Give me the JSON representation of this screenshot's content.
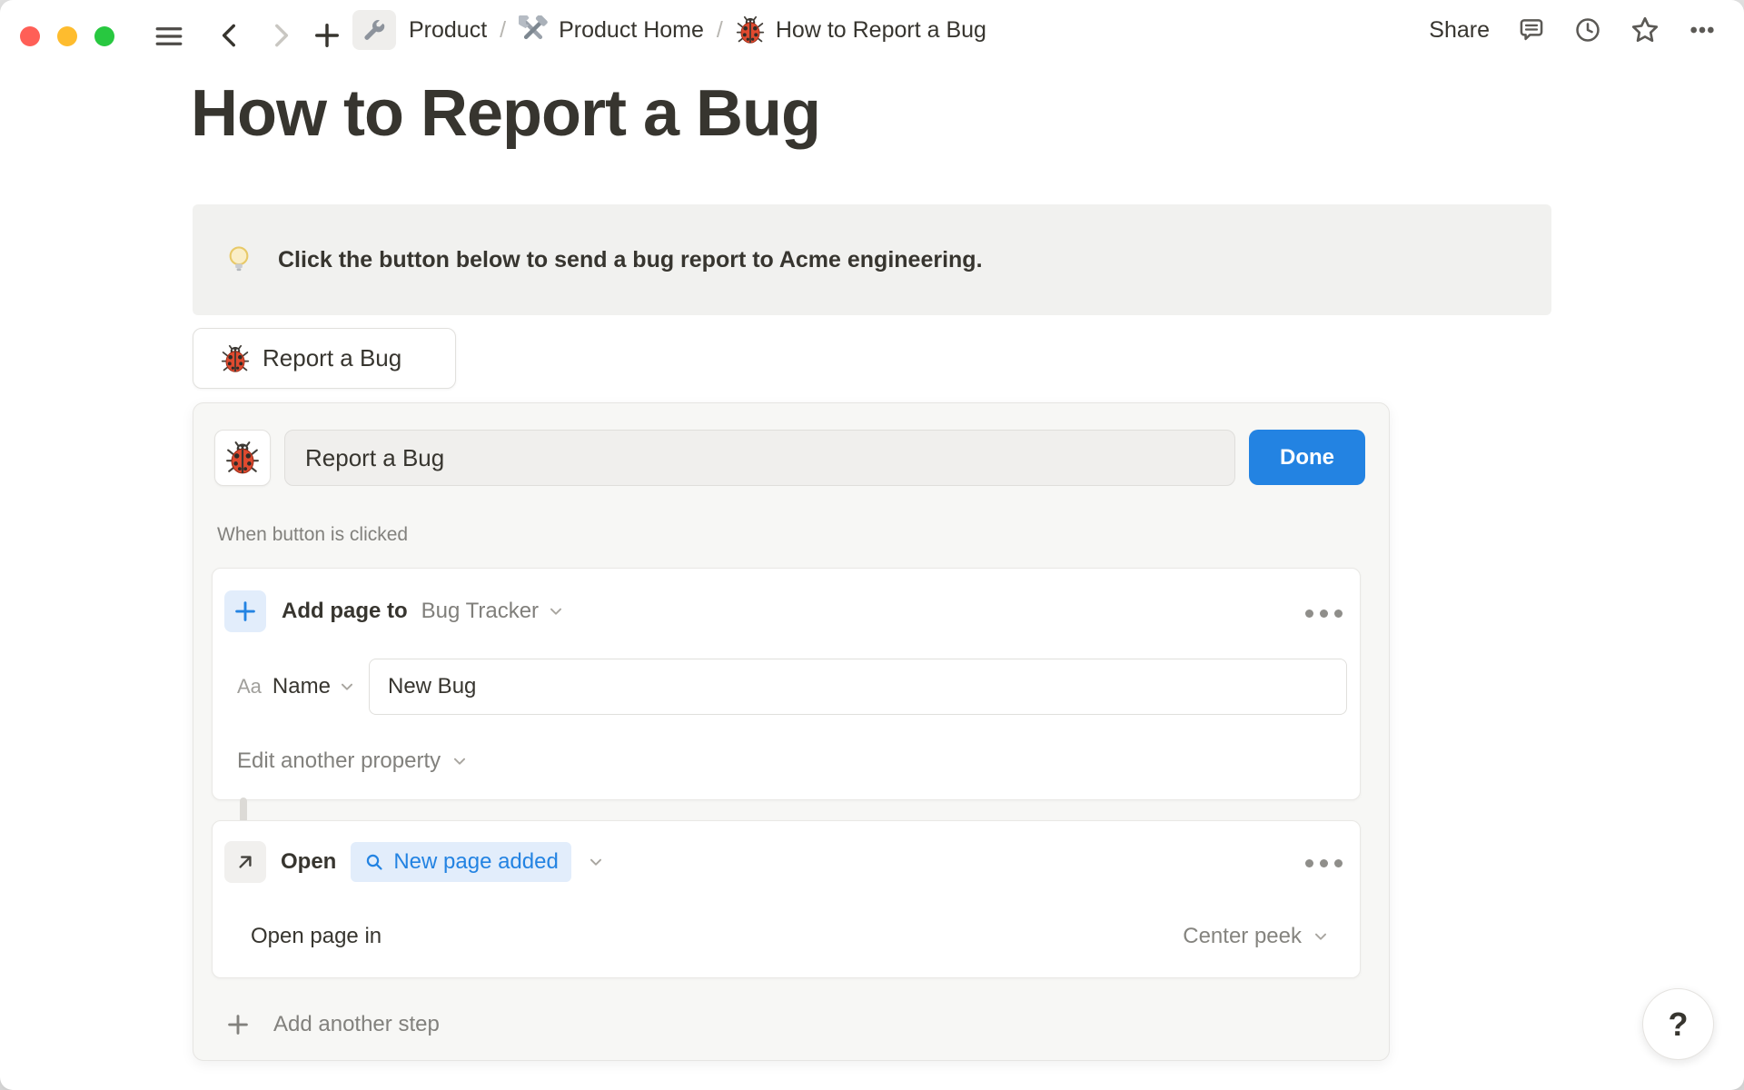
{
  "window": {
    "traffic_lights": [
      "close",
      "minimize",
      "zoom"
    ]
  },
  "toolbar": {
    "separator": "/",
    "breadcrumb": [
      {
        "icon": "wrench-emoji",
        "label": "Product"
      },
      {
        "icon": "hammer-wrench-emoji",
        "label": "Product Home"
      },
      {
        "icon": "ladybug-emoji",
        "label": "How to Report a Bug"
      }
    ],
    "share_label": "Share"
  },
  "page": {
    "title": "How to Report a Bug",
    "callout": {
      "icon": "lightbulb-emoji",
      "text": "Click the button below to send a bug report to Acme engineering."
    },
    "bug_button": {
      "icon": "ladybug-emoji",
      "label": "Report a Bug"
    }
  },
  "editor": {
    "icon": "ladybug-emoji",
    "button_name_value": "Report a Bug",
    "done_label": "Done",
    "trigger_label": "When button is clicked",
    "step_add_page": {
      "icon": "plus-icon",
      "action_label": "Add page to",
      "target_database": "Bug Tracker",
      "property_type": "Aa",
      "property_name": "Name",
      "property_value": "New Bug",
      "edit_another_label": "Edit another property"
    },
    "step_open": {
      "icon": "arrow-up-right-icon",
      "action_label": "Open",
      "target_chip": "New page added",
      "open_page_in_label": "Open page in",
      "open_page_in_value": "Center peek"
    },
    "add_step_label": "Add another step"
  },
  "help": {
    "label": "?"
  },
  "colors": {
    "accent_blue": "#2383e2",
    "text_primary": "#37352f",
    "text_secondary": "#82817d",
    "callout_bg": "#f1f1ef",
    "panel_bg": "#f7f7f5",
    "chip_bg": "#e2edfb",
    "traffic_red": "#ff5f57",
    "traffic_yellow": "#febc2e",
    "traffic_green": "#28c840"
  }
}
